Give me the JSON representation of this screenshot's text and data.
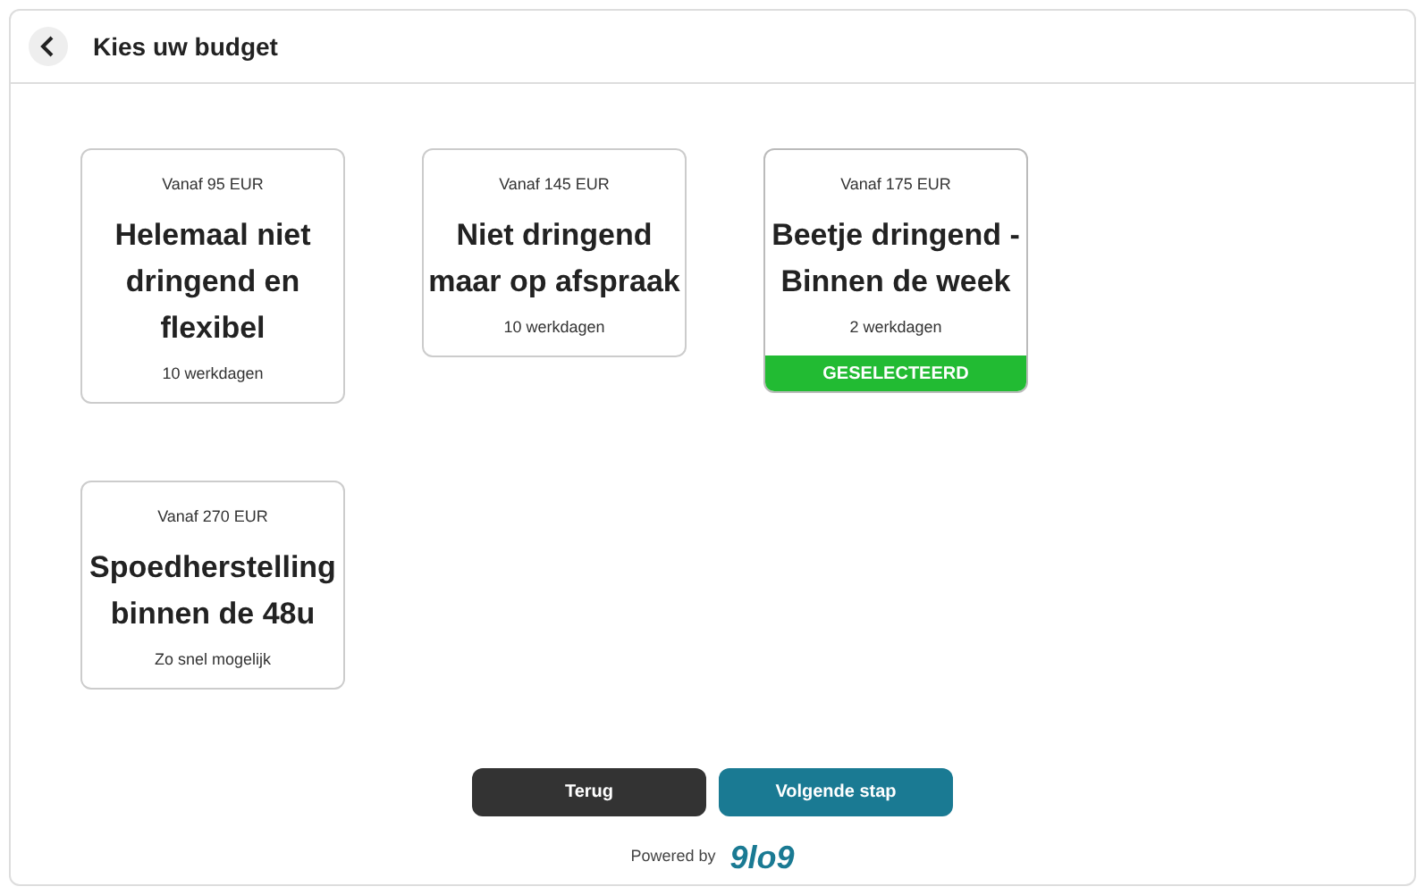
{
  "header": {
    "title": "Kies uw budget"
  },
  "cards": [
    {
      "price": "Vanaf 95 EUR",
      "title": "Helemaal niet dringend en flexibel",
      "duration": "10 werkdagen",
      "selected": false
    },
    {
      "price": "Vanaf 145 EUR",
      "title": "Niet dringend maar op afspraak",
      "duration": "10 werkdagen",
      "selected": false
    },
    {
      "price": "Vanaf 175 EUR",
      "title": "Beetje dringend - Binnen de week",
      "duration": "2 werkdagen",
      "selected": true
    },
    {
      "price": "Vanaf 270 EUR",
      "title": "Spoedherstelling binnen de 48u",
      "duration": "Zo snel mogelijk",
      "selected": false
    }
  ],
  "selected_badge": "GESELECTEERD",
  "buttons": [
    {
      "label": "Terug",
      "kind": "secondary"
    },
    {
      "label": "Volgende stap",
      "kind": "primary"
    }
  ],
  "footer": {
    "powered_by": "Powered by",
    "logo": "9lo9"
  }
}
